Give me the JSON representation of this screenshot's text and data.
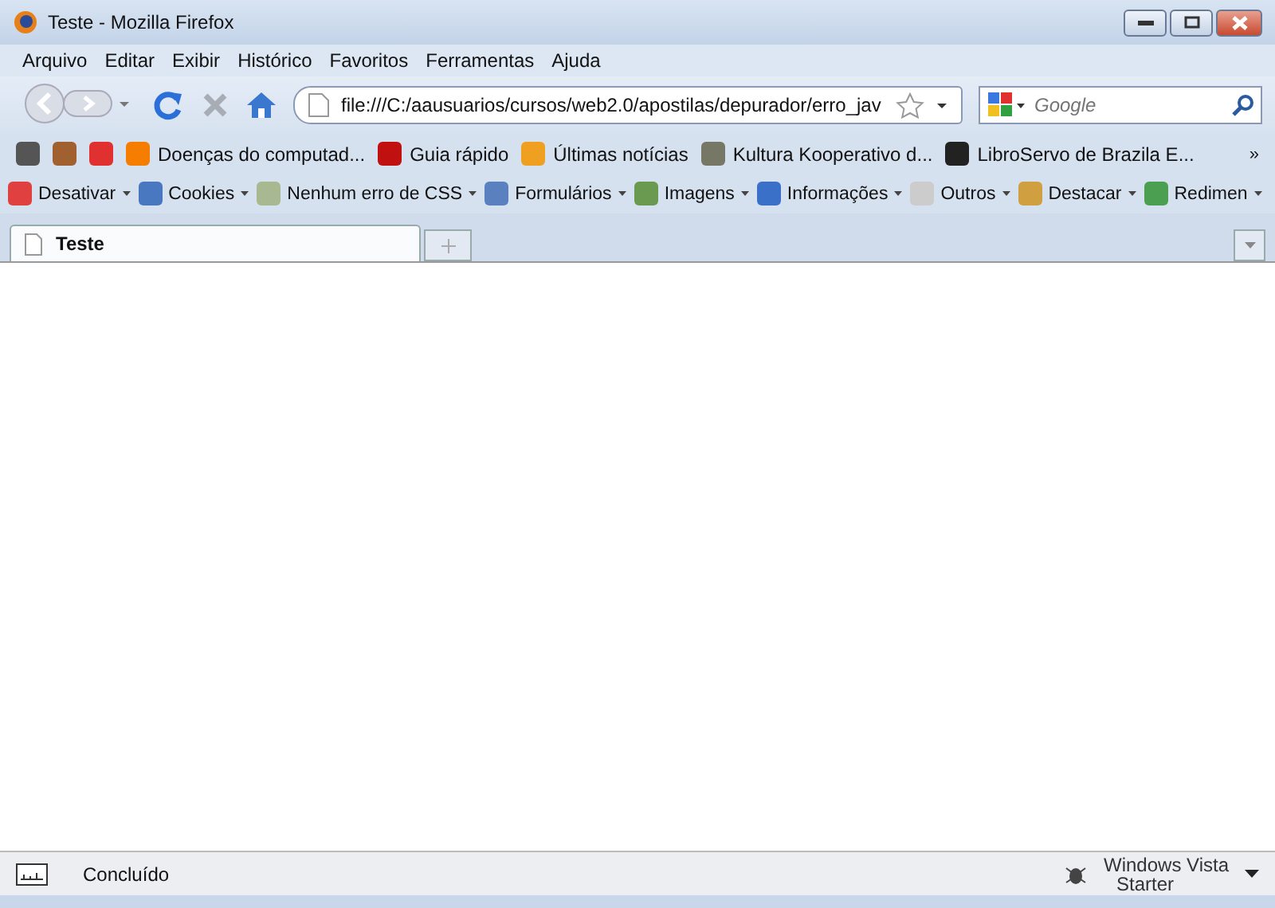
{
  "window": {
    "title": "Teste - Mozilla Firefox"
  },
  "menu": [
    "Arquivo",
    "Editar",
    "Exibir",
    "Histórico",
    "Favoritos",
    "Ferramentas",
    "Ajuda"
  ],
  "address_bar": {
    "value": "file:///C:/aausuarios/cursos/web2.0/apostilas/depurador/erro_jav"
  },
  "search": {
    "placeholder": "Google"
  },
  "bookmarks": [
    {
      "kind": "meter"
    },
    {
      "kind": "bug"
    },
    {
      "kind": "alert"
    },
    {
      "kind": "blogger",
      "label": "Doenças do computad..."
    },
    {
      "kind": "paw",
      "label": "Guia rápido"
    },
    {
      "kind": "rss",
      "label": "Últimas notícias"
    },
    {
      "kind": "rj",
      "label": "Kultura Kooperativo d..."
    },
    {
      "kind": "puzzle",
      "label": "LibroServo de Brazila E..."
    }
  ],
  "bookmarks_overflow": "»",
  "dev_toolbar": [
    {
      "kind": "disable",
      "label": "Desativar"
    },
    {
      "kind": "user",
      "label": "Cookies"
    },
    {
      "kind": "css",
      "label": "Nenhum erro de CSS"
    },
    {
      "kind": "form",
      "label": "Formulários"
    },
    {
      "kind": "image",
      "label": "Imagens"
    },
    {
      "kind": "info",
      "label": "Informações"
    },
    {
      "kind": "misc",
      "label": "Outros"
    },
    {
      "kind": "pen",
      "label": "Destacar"
    },
    {
      "kind": "resize",
      "label": "Redimen"
    }
  ],
  "tabs": [
    {
      "label": "Teste",
      "selected": true
    }
  ],
  "status_bar": {
    "text": "Concluído",
    "watermark_title": "Windows Vista",
    "watermark_edition": "Starter"
  }
}
